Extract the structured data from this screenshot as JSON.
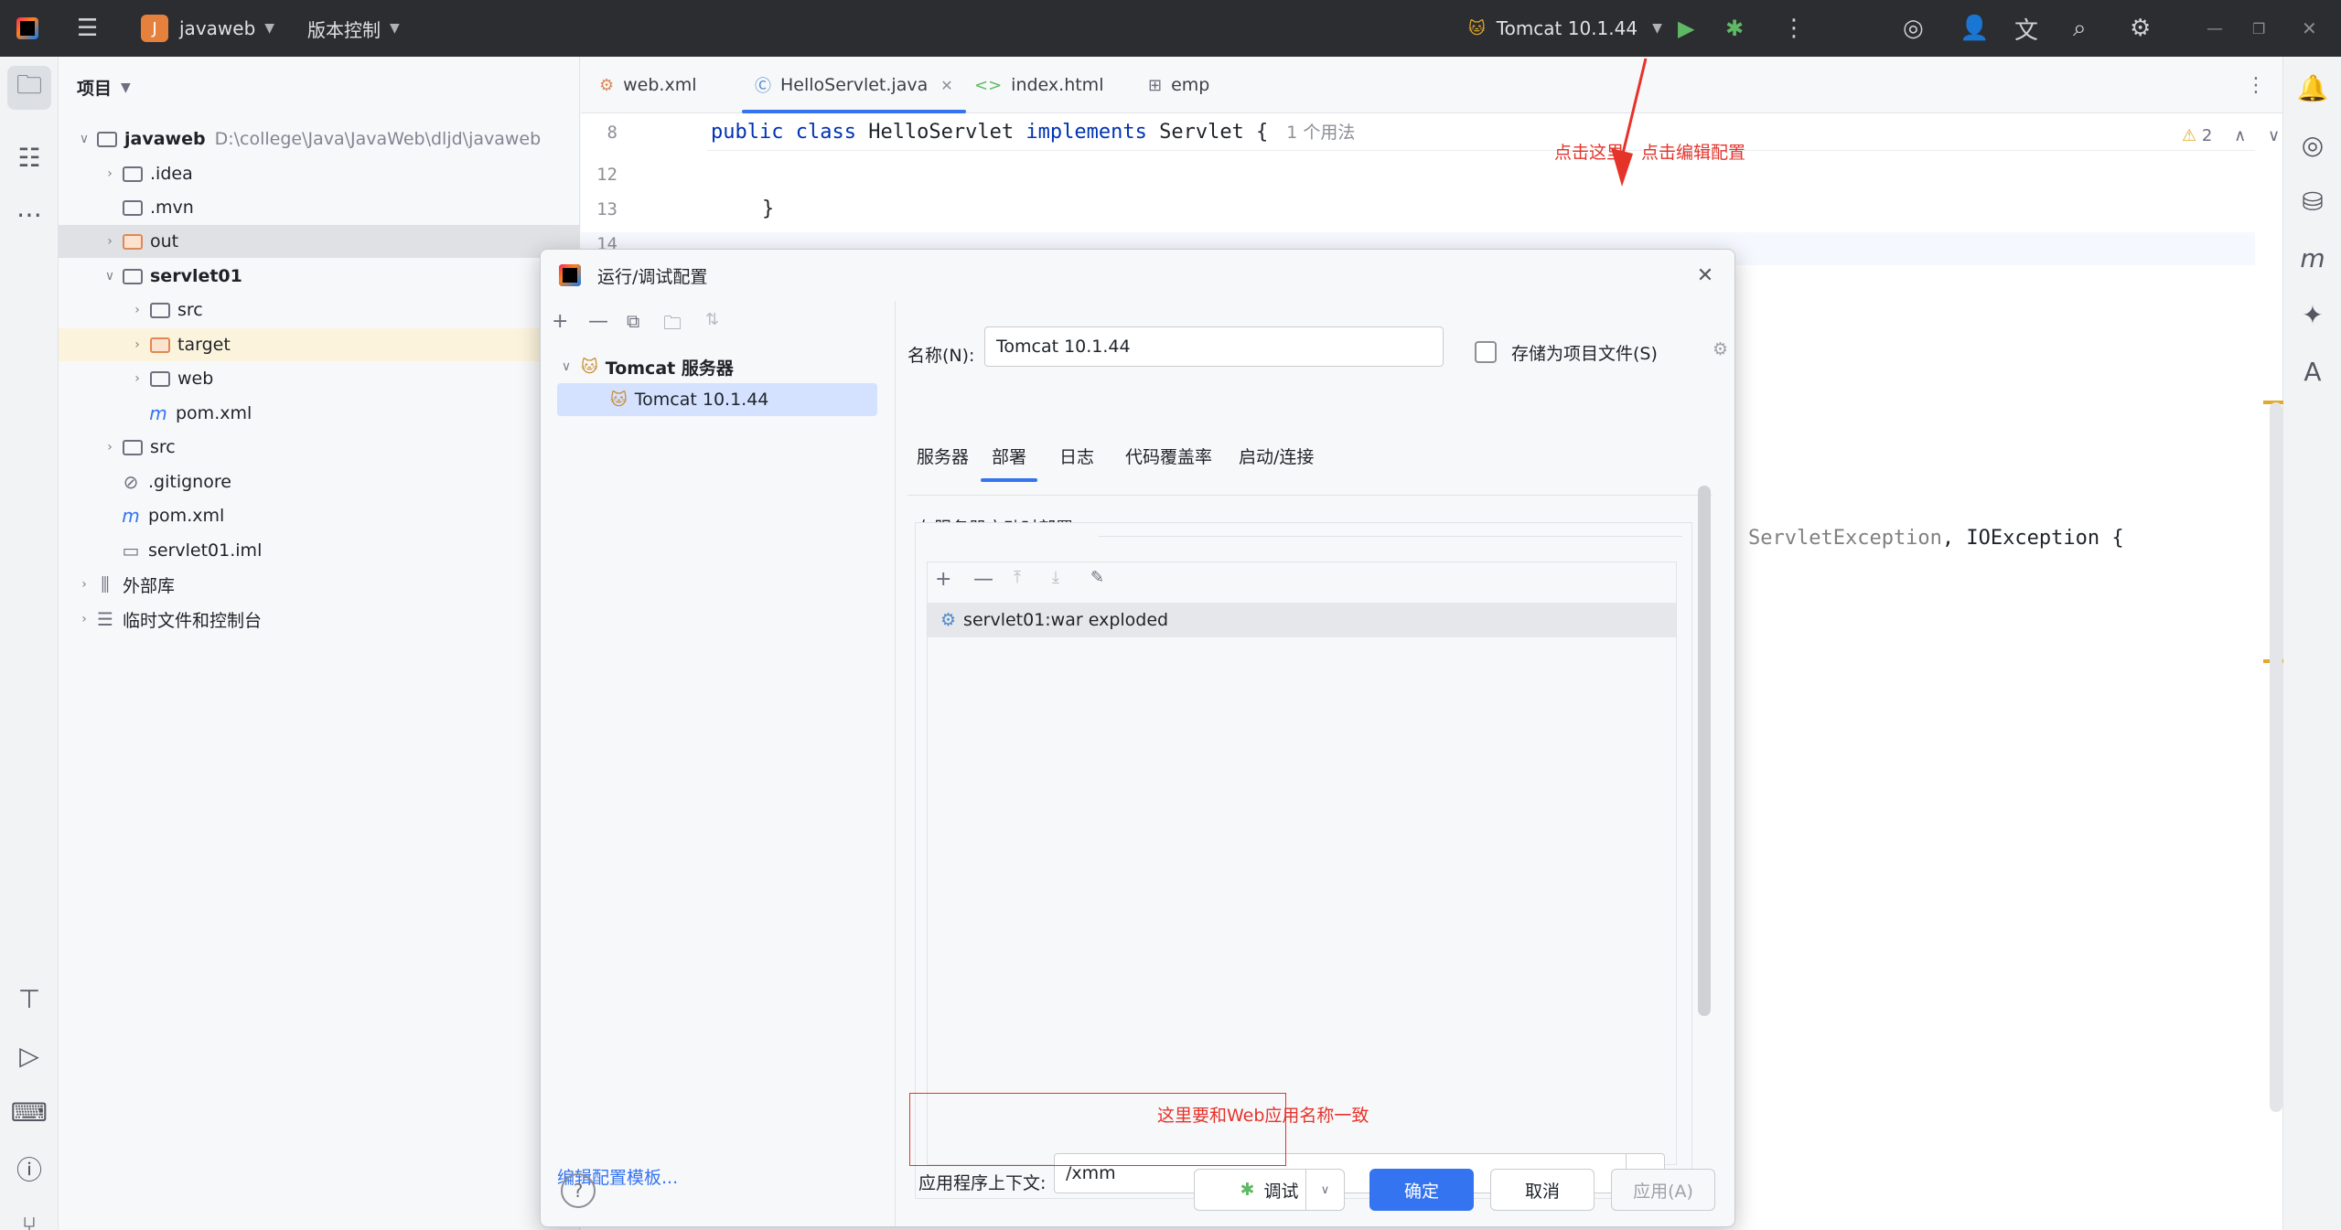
{
  "titlebar": {
    "project_letter": "J",
    "project_name": "javaweb",
    "vcs": "版本控制",
    "run_config": "Tomcat 10.1.44"
  },
  "project_panel": {
    "title": "项目",
    "tree": [
      {
        "label": "javaweb",
        "path": "D:\\college\\Java\\JavaWeb\\dljd\\javaweb"
      },
      {
        "label": ".idea"
      },
      {
        "label": ".mvn"
      },
      {
        "label": "out"
      },
      {
        "label": "servlet01"
      },
      {
        "label": "src"
      },
      {
        "label": "target"
      },
      {
        "label": "web"
      },
      {
        "label": "pom.xml"
      },
      {
        "label": "src"
      },
      {
        "label": ".gitignore"
      },
      {
        "label": "pom.xml"
      },
      {
        "label": "servlet01.iml"
      },
      {
        "label": "外部库"
      },
      {
        "label": "临时文件和控制台"
      }
    ]
  },
  "editor": {
    "tabs": [
      "web.xml",
      "HelloServlet.java",
      "index.html",
      "emp"
    ],
    "lines": [
      {
        "num": "8",
        "kw1": "public class",
        "name": " HelloServlet ",
        "kw2": "implements",
        "rest": " Servlet {",
        "usage": "1 个用法"
      },
      {
        "num": "12"
      },
      {
        "num": "13",
        "text": "}"
      },
      {
        "num": "14"
      }
    ],
    "right_code": {
      "a": "ServletException",
      "b": ", ",
      "c": "IOException",
      "d": " {"
    },
    "warning_count": "2",
    "annotation_top": "点击这里，点击编辑配置"
  },
  "dialog": {
    "title": "运行/调试配置",
    "tree_group": "Tomcat 服务器",
    "tree_item": "Tomcat 10.1.44",
    "edit_templates": "编辑配置模板...",
    "name_label": "名称(N):",
    "name_value": "Tomcat 10.1.44",
    "store_label": "存储为项目文件(S)",
    "subtabs": [
      "服务器",
      "部署",
      "日志",
      "代码覆盖率",
      "启动/连接"
    ],
    "deploy_section": "在服务器启动时部署",
    "artifact": "servlet01:war exploded",
    "annotation": "这里要和Web应用名称一致",
    "context_label": "应用程序上下文:",
    "context_value": "/xmm",
    "buttons": {
      "debug": "调试",
      "ok": "确定",
      "cancel": "取消",
      "apply": "应用(A)"
    }
  },
  "colors": {
    "accent": "#3574f0",
    "annotation": "#e5332a",
    "keyword": "#0033b3"
  }
}
